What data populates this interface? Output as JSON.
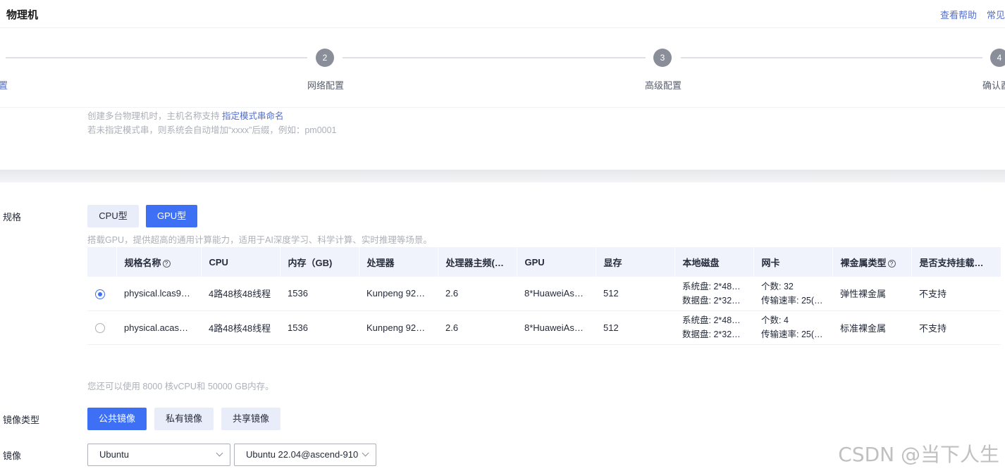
{
  "header": {
    "title": "物理机",
    "links": [
      "查看帮助",
      "常见"
    ]
  },
  "steps": [
    {
      "number": "",
      "label": "置"
    },
    {
      "number": "2",
      "label": "网络配置"
    },
    {
      "number": "3",
      "label": "高级配置"
    },
    {
      "number": "4",
      "label": "确认酉"
    }
  ],
  "hostname_hint": {
    "line1_prefix": "创建多台物理机时，主机名称支持 ",
    "line1_link": "指定模式串命名",
    "line2": "若未指定模式串，则系统会自动增加“xxxx”后缀，例如：pm0001"
  },
  "spec": {
    "label": "规格",
    "type_buttons": [
      "CPU型",
      "GPU型"
    ],
    "active_type": "GPU型",
    "description": "搭载GPU，提供超高的通用计算能力，适用于AI深度学习、科学计算、实时推理等场景。",
    "columns": [
      "规格名称",
      "CPU",
      "内存（GB)",
      "处理器",
      "处理器主频(G…",
      "GPU",
      "显存",
      "本地磁盘",
      "网卡",
      "裸金属类型",
      "是否支持挂载…"
    ],
    "rows": [
      {
        "selected": true,
        "name": "physical.lcas9…",
        "cpu": "4路48核48线程",
        "memory": "1536",
        "processor": "Kunpeng 92…",
        "freq": "2.6",
        "gpu": "8*HuaweiAsc…",
        "vram": "512",
        "disk_sys": "系统盘: 2*48…",
        "disk_data": "数据盘: 2*32…",
        "nic_count": "个数: 32",
        "nic_rate": "传输速率: 25(…",
        "bm_type": "弹性裸金属",
        "mount": "不支持"
      },
      {
        "selected": false,
        "name": "physical.acas9…",
        "cpu": "4路48核48线程",
        "memory": "1536",
        "processor": "Kunpeng 92…",
        "freq": "2.6",
        "gpu": "8*HuaweiAsc…",
        "vram": "512",
        "disk_sys": "系统盘: 2*48…",
        "disk_data": "数据盘: 2*32…",
        "nic_count": "个数: 4",
        "nic_rate": "传输速率: 25(…",
        "bm_type": "标准裸金属",
        "mount": "不支持"
      }
    ],
    "quota": "您还可以使用 8000 核vCPU和 50000 GB内存。"
  },
  "image_type": {
    "label": "镜像类型",
    "buttons": [
      "公共镜像",
      "私有镜像",
      "共享镜像"
    ],
    "active": "公共镜像"
  },
  "image": {
    "label": "镜像",
    "os_value": "Ubuntu",
    "version_value": "Ubuntu 22.04@ascend-910"
  },
  "watermark": "CSDN @当下人生"
}
